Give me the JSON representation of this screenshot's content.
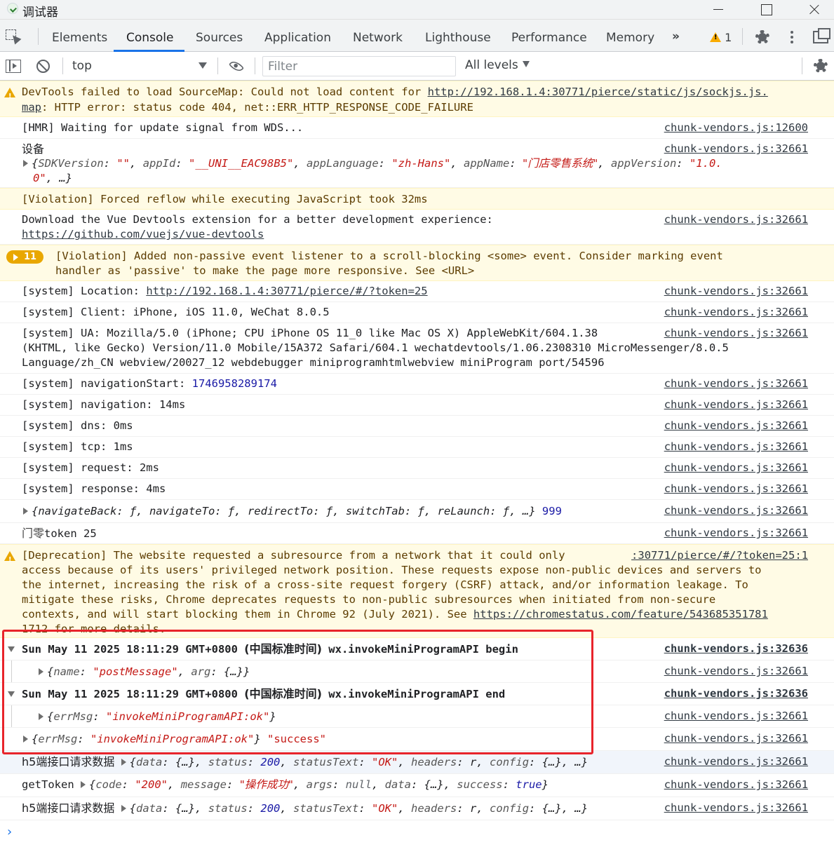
{
  "window": {
    "title": "调试器"
  },
  "tabs": [
    "Elements",
    "Console",
    "Sources",
    "Application",
    "Network",
    "Lighthouse",
    "Performance",
    "Memory"
  ],
  "more_tabs": "»",
  "warning_count": "1",
  "toolbar": {
    "context": "top",
    "filter_placeholder": "Filter",
    "filter_value": "",
    "levels": "All levels"
  },
  "rows": {
    "sourcemap": {
      "line1_prefix": "DevTools failed to load SourceMap: Could not load content for ",
      "line1_link": "http://192.168.1.4:30771/pierce/static/js/sockjs.js.",
      "line2_link": "map",
      "line2_rest": ": HTTP error: status code 404, net::ERR_HTTP_RESPONSE_CODE_FAILURE"
    },
    "hmr": {
      "text": "[HMR] Waiting for update signal from WDS...",
      "source": "chunk-vendors.js:12600"
    },
    "device": {
      "label": "设备",
      "source": "chunk-vendors.js:32661",
      "obj_open": "{",
      "k1": "SDKVersion",
      "v1": "\"\"",
      "k2": "appId",
      "v2": "\"__UNI__EAC98B5\"",
      "k3": "appLanguage",
      "v3": "\"zh-Hans\"",
      "k4": "appName",
      "v4": "\"门店零售系统\"",
      "k5": "appVersion",
      "v5a": "\"1.0.",
      "v5b": "0\"",
      "obj_close": ", …}"
    },
    "violation_reflow": {
      "text": "[Violation] Forced reflow while executing JavaScript took 32ms"
    },
    "vue_devtools": {
      "line1": "Download the Vue Devtools extension for a better development experience:",
      "link": "https://github.com/vuejs/vue-devtools",
      "source": "chunk-vendors.js:32661"
    },
    "violation_listener": {
      "count": "11",
      "line1": "[Violation] Added non-passive event listener to a scroll-blocking <some> event. Consider marking event",
      "line2": "handler as 'passive' to make the page more responsive. See <URL>"
    },
    "location": {
      "prefix": "[system] Location: ",
      "link": "http://192.168.1.4:30771/pierce/#/?token=25",
      "source": "chunk-vendors.js:32661"
    },
    "client": {
      "text": "[system] Client: iPhone, iOS 11.0, WeChat 8.0.5",
      "source": "chunk-vendors.js:32661"
    },
    "ua": {
      "line1": "[system] UA: Mozilla/5.0 (iPhone; CPU iPhone OS 11_0 like Mac OS X) AppleWebKit/604.1.38",
      "line2": "(KHTML, like Gecko) Version/11.0 Mobile/15A372 Safari/604.1 wechatdevtools/1.06.2308310 MicroMessenger/8.0.5",
      "line3": "Language/zh_CN webview/20027_12 webdebugger miniprogramhtmlwebview miniProgram port/54596",
      "source": "chunk-vendors.js:32661"
    },
    "nav_start": {
      "prefix": "[system] navigationStart: ",
      "value": "1746958289174",
      "source": "chunk-vendors.js:32661"
    },
    "navigation": {
      "text": "[system] navigation: 14ms",
      "source": "chunk-vendors.js:32661"
    },
    "dns": {
      "text": "[system] dns: 0ms",
      "source": "chunk-vendors.js:32661"
    },
    "tcp": {
      "text": "[system] tcp: 1ms",
      "source": "chunk-vendors.js:32661"
    },
    "request": {
      "text": "[system] request: 2ms",
      "source": "chunk-vendors.js:32661"
    },
    "response": {
      "text": "[system] response: 4ms",
      "source": "chunk-vendors.js:32661"
    },
    "nav_obj": {
      "text": "{navigateBack: ƒ, navigateTo: ƒ, redirectTo: ƒ, switchTab: ƒ, reLaunch: ƒ, …}",
      "num": "999",
      "source": "chunk-vendors.js:32661"
    },
    "token": {
      "label": "门零",
      "text": "token 25",
      "source": "chunk-vendors.js:32661"
    },
    "deprecation": {
      "line1": "[Deprecation] The website requested a subresource from a network that it could only",
      "line2": "access because of its users' privileged network position. These requests expose non-public devices and servers to",
      "line3": "the internet, increasing the risk of a cross-site request forgery (CSRF) attack, and/or information leakage. To",
      "line4": "mitigate these risks, Chrome deprecates requests to non-public subresources when initiated from non-secure",
      "line5_prefix": "contexts, and will start blocking them in Chrome 92 (July 2021). See ",
      "line5_link": "https://chromestatus.com/feature/543685351781",
      "line6": "1712 for more details.",
      "source": ":30771/pierce/#/?token=25:1"
    },
    "group_begin": {
      "date": "Sun May 11 2025 18:11:29 GMT+0800",
      "tz": "(中国标准时间)",
      "tail": "wx.invokeMiniProgramAPI begin",
      "source": "chunk-vendors.js:32636"
    },
    "post_msg": {
      "k1": "name",
      "v1": "\"postMessage\"",
      "k2": "arg",
      "v2": "{…}",
      "source": "chunk-vendors.js:32661"
    },
    "group_end": {
      "date": "Sun May 11 2025 18:11:29 GMT+0800",
      "tz": "(中国标准时间)",
      "tail": "wx.invokeMiniProgramAPI end",
      "source": "chunk-vendors.js:32636"
    },
    "errmsg_inner": {
      "k": "errMsg",
      "v": "\"invokeMiniProgramAPI:ok\"",
      "source": "chunk-vendors.js:32661"
    },
    "errmsg_outer": {
      "k": "errMsg",
      "v": "\"invokeMiniProgramAPI:ok\"",
      "extra": "\"success\"",
      "source": "chunk-vendors.js:32661"
    },
    "h5_1": {
      "label": "h5端接口请求数据",
      "k1": "data",
      "v1": "{…}",
      "k2": "status",
      "v2": "200",
      "k3": "statusText",
      "v3": "\"OK\"",
      "k4": "headers",
      "v4": "r",
      "k5": "config",
      "v5": "{…}",
      "source": "chunk-vendors.js:32661"
    },
    "gettoken": {
      "label": "getToken",
      "k1": "code",
      "v1": "\"200\"",
      "k2": "message",
      "v2": "\"操作成功\"",
      "k3": "args",
      "v3": "null",
      "k4": "data",
      "v4": "{…}",
      "k5": "success",
      "v5": "true",
      "source": "chunk-vendors.js:32661"
    },
    "h5_2": {
      "label": "h5端接口请求数据",
      "k1": "data",
      "v1": "{…}",
      "k2": "status",
      "v2": "200",
      "k3": "statusText",
      "v3": "\"OK\"",
      "k4": "headers",
      "v4": "r",
      "k5": "config",
      "v5": "{…}",
      "source": "chunk-vendors.js:32661"
    }
  },
  "colors": {
    "accent": "#1a73e8",
    "warning_bg": "#fffbe5",
    "highlight": "#e8242b"
  }
}
